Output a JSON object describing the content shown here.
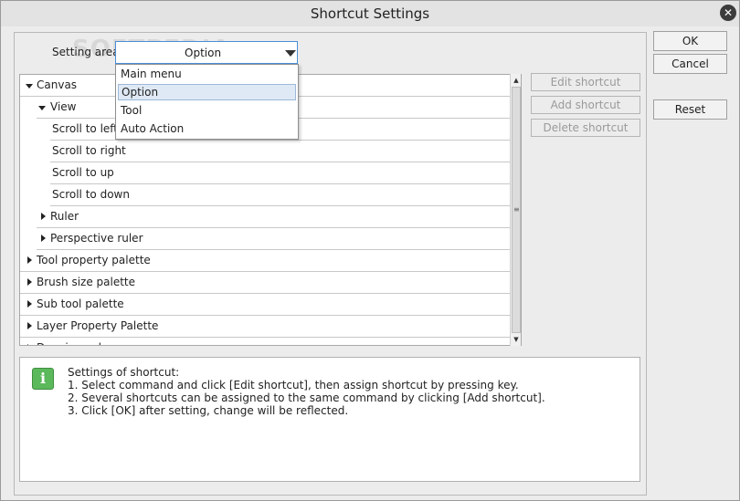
{
  "window": {
    "title": "Shortcut Settings"
  },
  "setting_area": {
    "label": "Setting area:",
    "value": "Option",
    "options": [
      "Main menu",
      "Option",
      "Tool",
      "Auto Action"
    ]
  },
  "tree": {
    "rows": [
      {
        "label": "Canvas",
        "state": "expanded"
      },
      {
        "label": "View",
        "state": "expanded"
      },
      {
        "label": "Scroll to left",
        "state": "leaf"
      },
      {
        "label": "Scroll to right",
        "state": "leaf"
      },
      {
        "label": "Scroll to up",
        "state": "leaf"
      },
      {
        "label": "Scroll to down",
        "state": "leaf"
      },
      {
        "label": "Ruler",
        "state": "collapsed"
      },
      {
        "label": "Perspective ruler",
        "state": "collapsed"
      },
      {
        "label": "Tool property palette",
        "state": "collapsed"
      },
      {
        "label": "Brush size palette",
        "state": "collapsed"
      },
      {
        "label": "Sub tool palette",
        "state": "collapsed"
      },
      {
        "label": "Layer Property Palette",
        "state": "collapsed"
      },
      {
        "label": "Drawing color",
        "state": "collapsed"
      }
    ]
  },
  "shortcut_buttons": {
    "edit": "Edit shortcut",
    "add": "Add shortcut",
    "delete": "Delete shortcut"
  },
  "dialog_buttons": {
    "ok": "OK",
    "cancel": "Cancel",
    "reset": "Reset"
  },
  "info": {
    "icon": "info-icon",
    "lines": [
      "Settings of shortcut:",
      "1. Select command and click [Edit shortcut], then assign shortcut by pressing key.",
      "2. Several shortcuts can be assigned to the same command by clicking [Add shortcut].",
      "3. Click [OK] after setting, change will be reflected."
    ]
  },
  "watermark": "SOFTPEDIA"
}
